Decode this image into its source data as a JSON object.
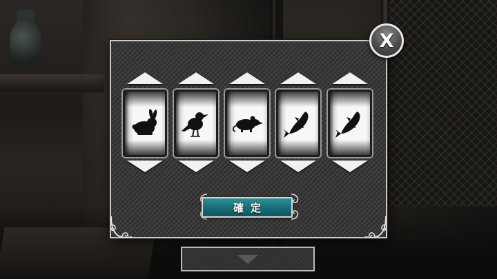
{
  "dialog": {
    "close_label": "X",
    "confirm_label": "確定"
  },
  "reels": [
    {
      "symbol": "rabbit-icon"
    },
    {
      "symbol": "bird-icon"
    },
    {
      "symbol": "rat-icon"
    },
    {
      "symbol": "fish-icon"
    },
    {
      "symbol": "fish-icon"
    }
  ],
  "colors": {
    "panel": "#3a3a3a",
    "confirm_button": "#1a6e79",
    "reel_face": "#f7f7f7",
    "arrow": "#f1f1f1"
  }
}
